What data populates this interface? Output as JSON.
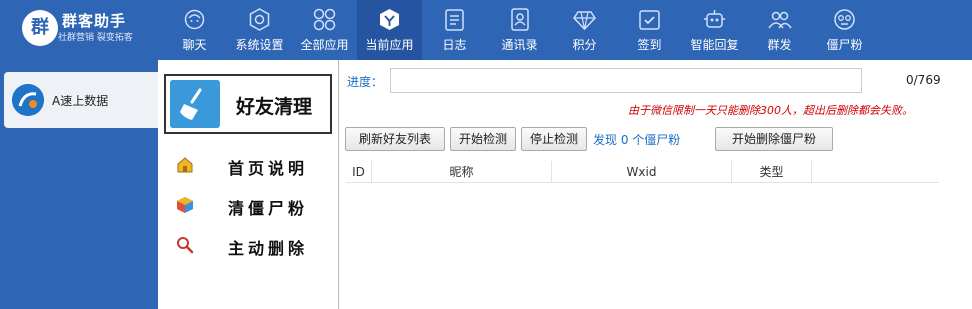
{
  "app": {
    "title": "群客助手",
    "subtitle": "社群营销 裂变拓客",
    "logo_char": "群"
  },
  "nav": {
    "items": [
      {
        "label": "聊天",
        "icon": "chat-icon",
        "active": false
      },
      {
        "label": "系统设置",
        "icon": "settings-icon",
        "active": false
      },
      {
        "label": "全部应用",
        "icon": "apps-icon",
        "active": false
      },
      {
        "label": "当前应用",
        "icon": "cube-icon",
        "active": true
      },
      {
        "label": "日志",
        "icon": "log-icon",
        "active": false
      },
      {
        "label": "通讯录",
        "icon": "contacts-icon",
        "active": false
      },
      {
        "label": "积分",
        "icon": "diamond-icon",
        "active": false
      },
      {
        "label": "签到",
        "icon": "checkin-icon",
        "active": false
      },
      {
        "label": "智能回复",
        "icon": "robot-icon",
        "active": false
      },
      {
        "label": "群发",
        "icon": "group-icon",
        "active": false
      },
      {
        "label": "僵尸粉",
        "icon": "zombie-icon",
        "active": false
      }
    ]
  },
  "account": {
    "name": "A速上数据"
  },
  "menu": {
    "header": "好友清理",
    "items": [
      {
        "label": "首页说明",
        "icon": "home-icon"
      },
      {
        "label": "清僵尸粉",
        "icon": "box-icon"
      },
      {
        "label": "主动删除",
        "icon": "search-delete-icon"
      }
    ]
  },
  "progress": {
    "label": "进度：",
    "count": "0/769",
    "fraction": 0
  },
  "warning": "由于微信限制一天只能删除300人，超出后删除都会失败。",
  "buttons": {
    "refresh": "刷新好友列表",
    "start": "开始检测",
    "stop": "停止检测",
    "delete": "开始删除僵尸粉"
  },
  "found_text": "发现 0 个僵尸粉",
  "table": {
    "columns": [
      "ID",
      "昵称",
      "Wxid",
      "类型"
    ]
  },
  "colors": {
    "nav_bg": "#2f65b5",
    "nav_active": "#2554a0",
    "link": "#1a6fc4",
    "warning": "#d40000"
  }
}
